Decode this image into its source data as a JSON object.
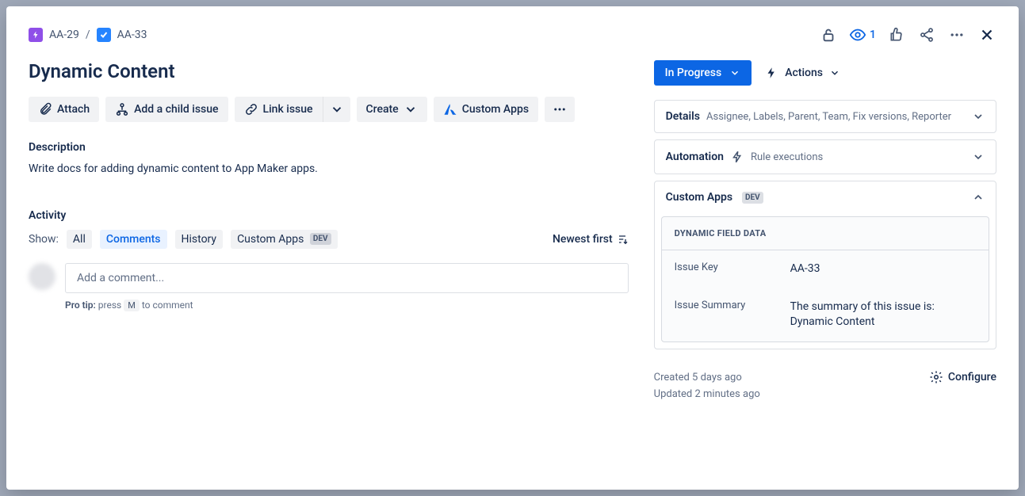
{
  "breadcrumb": {
    "parent": "AA-29",
    "current": "AA-33"
  },
  "topActions": {
    "watchCount": "1"
  },
  "issue": {
    "title": "Dynamic Content",
    "description": "Write docs for adding dynamic content to App Maker apps."
  },
  "buttons": {
    "attach": "Attach",
    "addChild": "Add a child issue",
    "linkIssue": "Link issue",
    "create": "Create",
    "customApps": "Custom Apps"
  },
  "sections": {
    "description": "Description",
    "activity": "Activity"
  },
  "activity": {
    "showLabel": "Show:",
    "tabs": {
      "all": "All",
      "comments": "Comments",
      "history": "History",
      "custom": "Custom Apps",
      "customBadge": "DEV"
    },
    "sort": "Newest first",
    "commentPlaceholder": "Add a comment...",
    "proTipBold": "Pro tip:",
    "proTipPrefix": "press",
    "proTipKey": "M",
    "proTipSuffix": "to comment"
  },
  "right": {
    "status": "In Progress",
    "actions": "Actions",
    "details": {
      "label": "Details",
      "sub": "Assignee, Labels, Parent, Team, Fix versions, Reporter"
    },
    "automation": {
      "label": "Automation",
      "sub": "Rule executions"
    },
    "customApps": {
      "label": "Custom Apps",
      "badge": "DEV",
      "panel": {
        "head": "DYNAMIC FIELD DATA",
        "rows": [
          {
            "k": "Issue Key",
            "v": "AA-33"
          },
          {
            "k": "Issue Summary",
            "v": "The summary of this issue is: Dynamic Content"
          }
        ]
      }
    },
    "timestamps": {
      "created": "Created 5 days ago",
      "updated": "Updated 2 minutes ago"
    },
    "configure": "Configure"
  }
}
